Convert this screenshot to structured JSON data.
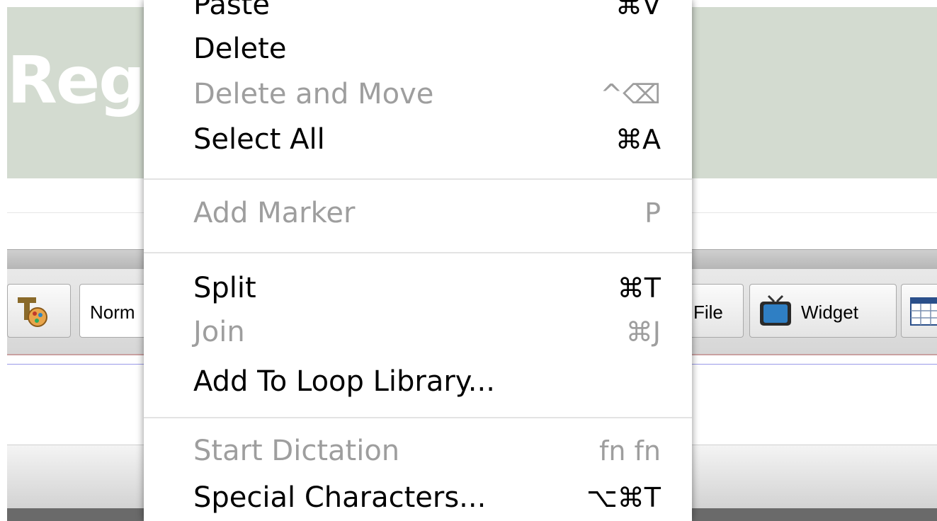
{
  "background": {
    "header_title": "Regi",
    "toolbar": {
      "format_select_value": "Norm",
      "file_button_label": "File",
      "widget_button_label": "Widget"
    }
  },
  "menu": {
    "items": [
      {
        "label": "Paste",
        "shortcut": "⌘V",
        "enabled": true
      },
      {
        "label": "Delete",
        "shortcut": "",
        "enabled": true
      },
      {
        "label": "Delete and Move",
        "shortcut": "^⌫",
        "enabled": false
      },
      {
        "label": "Select All",
        "shortcut": "⌘A",
        "enabled": true
      },
      {
        "label": "Add Marker",
        "shortcut": "P",
        "enabled": false
      },
      {
        "label": "Split",
        "shortcut": "⌘T",
        "enabled": true
      },
      {
        "label": "Join",
        "shortcut": "⌘J",
        "enabled": false
      },
      {
        "label": "Add To Loop Library...",
        "shortcut": "",
        "enabled": true
      },
      {
        "label": "Start Dictation",
        "shortcut": "fn fn",
        "enabled": false
      },
      {
        "label": "Special Characters...",
        "shortcut": "⌥⌘T",
        "enabled": true
      }
    ]
  },
  "colors": {
    "header_band": "#d3dbd0",
    "menu_text": "#000000",
    "menu_disabled_text": "#9e9e9e"
  }
}
